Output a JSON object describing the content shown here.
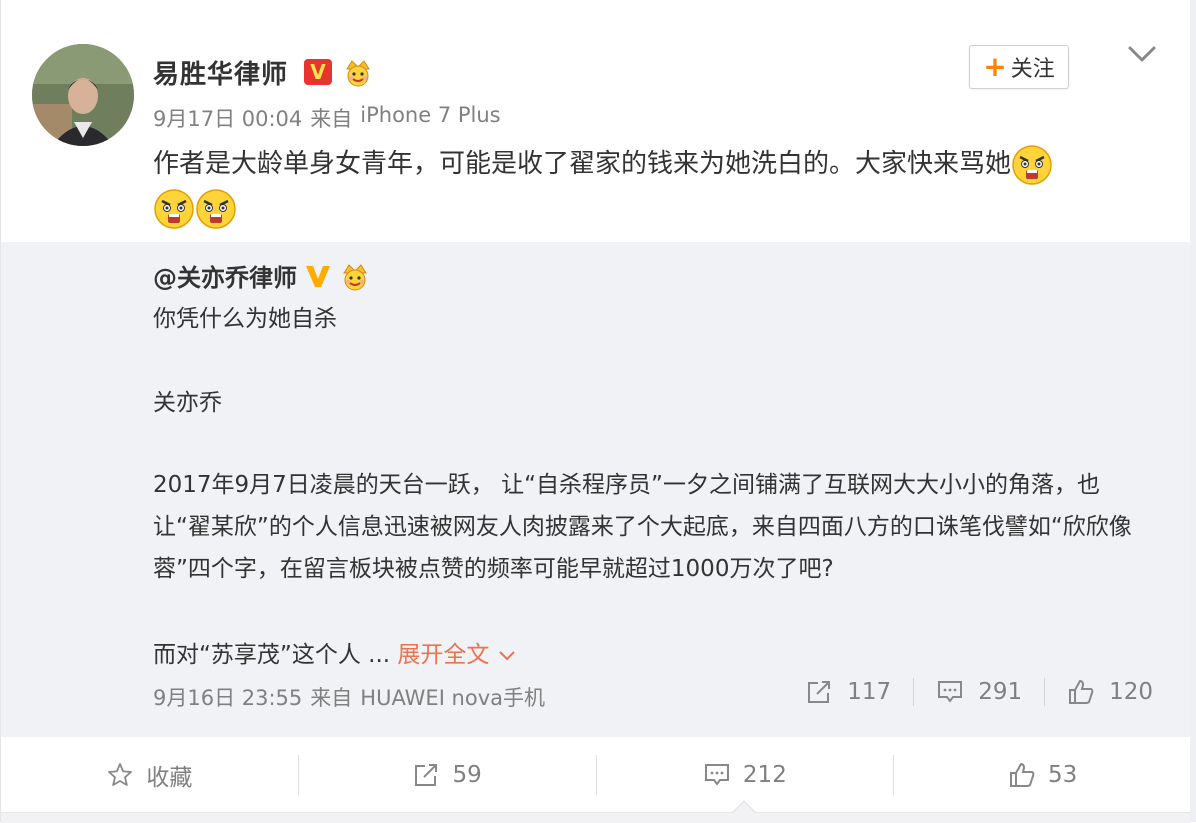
{
  "post": {
    "author": "易胜华律师",
    "timestamp": "9月17日 00:04",
    "source_prefix": "来自",
    "source": "iPhone 7 Plus",
    "text": "作者是大龄单身女青年，可能是收了翟家的钱来为她洗白的。大家快来骂她",
    "emoji_count": 3,
    "follow_label": "关注"
  },
  "repost": {
    "author": "@关亦乔律师",
    "line1": "你凭什么为她自杀",
    "line2": "关亦乔",
    "paragraph": "2017年9月7日凌晨的天台一跃， 让“自杀程序员”一夕之间铺满了互联网大大小小的角落，也让“翟某欣”的个人信息迅速被网友人肉披露来了个大起底，来自四面八方的口诛笔伐譬如“欣欣像蓉”四个字，在留言板块被点赞的频率可能早就超过1000万次了吧?",
    "line3": "而对“苏享茂”这个人 ...",
    "expand_label": "展开全文",
    "timestamp": "9月16日 23:55",
    "source_prefix": "来自",
    "source": "HUAWEI nova手机",
    "repost_count": "117",
    "comment_count": "291",
    "like_count": "120"
  },
  "toolbar": {
    "favorite_label": "收藏",
    "repost_count": "59",
    "comment_count": "212",
    "like_count": "53"
  },
  "colors": {
    "v_badge": "#e7342e",
    "follow_plus": "#ff8200",
    "expand_link": "#eb7350",
    "repost_bg": "#f1f2f5"
  },
  "icons": [
    "avatar",
    "v-badge-icon",
    "crown-icon",
    "angry-emoji-icon",
    "chevron-down-icon",
    "repost-icon",
    "comment-icon",
    "like-icon",
    "star-icon"
  ]
}
